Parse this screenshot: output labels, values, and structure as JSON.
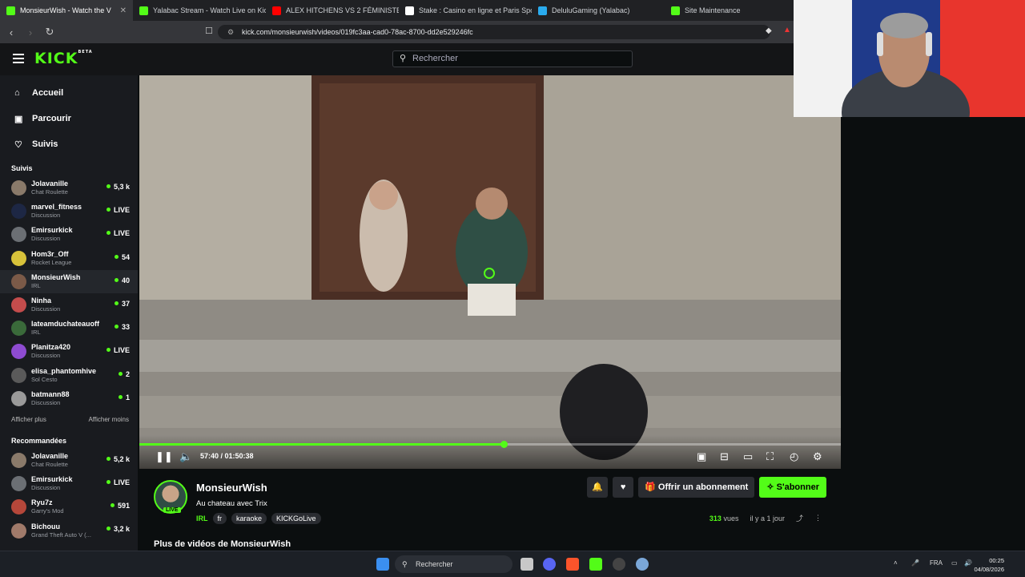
{
  "tabs": [
    {
      "label": "MonsieurWish - Watch the V",
      "active": true,
      "color": "#53fc18"
    },
    {
      "label": "Yalabac Stream - Watch Live on Kick",
      "active": false,
      "color": "#53fc18"
    },
    {
      "label": "ALEX HITCHENS VS 2 FÉMINISTES !",
      "active": false,
      "color": "#ff0000"
    },
    {
      "label": "Stake : Casino en ligne et Paris Sportif",
      "active": false,
      "color": "#ffffff"
    },
    {
      "label": "DeluluGaming (Yalabac)",
      "active": false,
      "color": "#2aabee"
    },
    {
      "label": "Site Maintenance",
      "active": false,
      "color": "#53fc18"
    }
  ],
  "address": {
    "url": "kick.com/monsieurwish/videos/019fc3aa-cad0-78ac-8700-dd2e529246fc"
  },
  "header": {
    "logo": "KICK",
    "logo_badge": "BETA",
    "search_placeholder": "Rechercher"
  },
  "sidebar": {
    "nav": [
      {
        "label": "Accueil",
        "icon": "home-icon"
      },
      {
        "label": "Parcourir",
        "icon": "browse-icon"
      },
      {
        "label": "Suivis",
        "icon": "heart-icon"
      }
    ],
    "followed_title": "Suivis",
    "followed": [
      {
        "name": "Jolavanille",
        "category": "Chat Roulette",
        "viewers": "5,3 k",
        "color": "#8a7a6a"
      },
      {
        "name": "marvel_fitness",
        "category": "Discussion",
        "viewers": "LIVE",
        "color": "#1d2744"
      },
      {
        "name": "Emirsurkick",
        "category": "Discussion",
        "viewers": "LIVE",
        "color": "#6b6f74"
      },
      {
        "name": "Hom3r_Off",
        "category": "Rocket League",
        "viewers": "54",
        "color": "#d8c23a"
      },
      {
        "name": "MonsieurWish",
        "category": "IRL",
        "viewers": "40",
        "color": "#7b5a48",
        "selected": true
      },
      {
        "name": "Ninha",
        "category": "Discussion",
        "viewers": "37",
        "color": "#c44c4c"
      },
      {
        "name": "lateamduchateauoff",
        "category": "IRL",
        "viewers": "33",
        "color": "#3a6a3a"
      },
      {
        "name": "Planitza420",
        "category": "Discussion",
        "viewers": "LIVE",
        "color": "#8e4bd1"
      },
      {
        "name": "elisa_phantomhive",
        "category": "Sol Cesto",
        "viewers": "2",
        "color": "#5a5a5a"
      },
      {
        "name": "batmann88",
        "category": "Discussion",
        "viewers": "1",
        "color": "#9a9a9a"
      }
    ],
    "show_more": "Afficher plus",
    "show_less": "Afficher moins",
    "recommended_title": "Recommandées",
    "recommended": [
      {
        "name": "Jolavanille",
        "category": "Chat Roulette",
        "viewers": "5,2 k",
        "color": "#8a7a6a"
      },
      {
        "name": "Emirsurkick",
        "category": "Discussion",
        "viewers": "LIVE",
        "color": "#6b6f74"
      },
      {
        "name": "Ryu7z",
        "category": "Garry's Mod",
        "viewers": "591",
        "color": "#b5473a"
      },
      {
        "name": "Bichouu",
        "category": "Grand Theft Auto V (...",
        "viewers": "3,2 k",
        "color": "#a07a6a"
      }
    ]
  },
  "player": {
    "time": "57:40 / 01:50:38",
    "progress": 0.52
  },
  "video": {
    "channel": "MonsieurWish",
    "live_badge": "LIVE",
    "title": "Au chateau avec Trix",
    "category": "IRL",
    "tags": [
      "fr",
      "karaoke",
      "KICKGoLive"
    ],
    "gift_label": "Offrir un abonnement",
    "subscribe_label": "S'abonner",
    "views_count": "313",
    "views_label": "vues",
    "posted": "il y a 1 jour",
    "more_videos": "Plus de vidéos de MonsieurWish"
  },
  "taskbar": {
    "search_placeholder": "Rechercher",
    "language": "FRA",
    "time": "00:25",
    "date": "04/08/2026"
  },
  "colors": {
    "accent": "#53fc18",
    "sidebar": "#191b1f",
    "background": "#0b0e0f"
  }
}
